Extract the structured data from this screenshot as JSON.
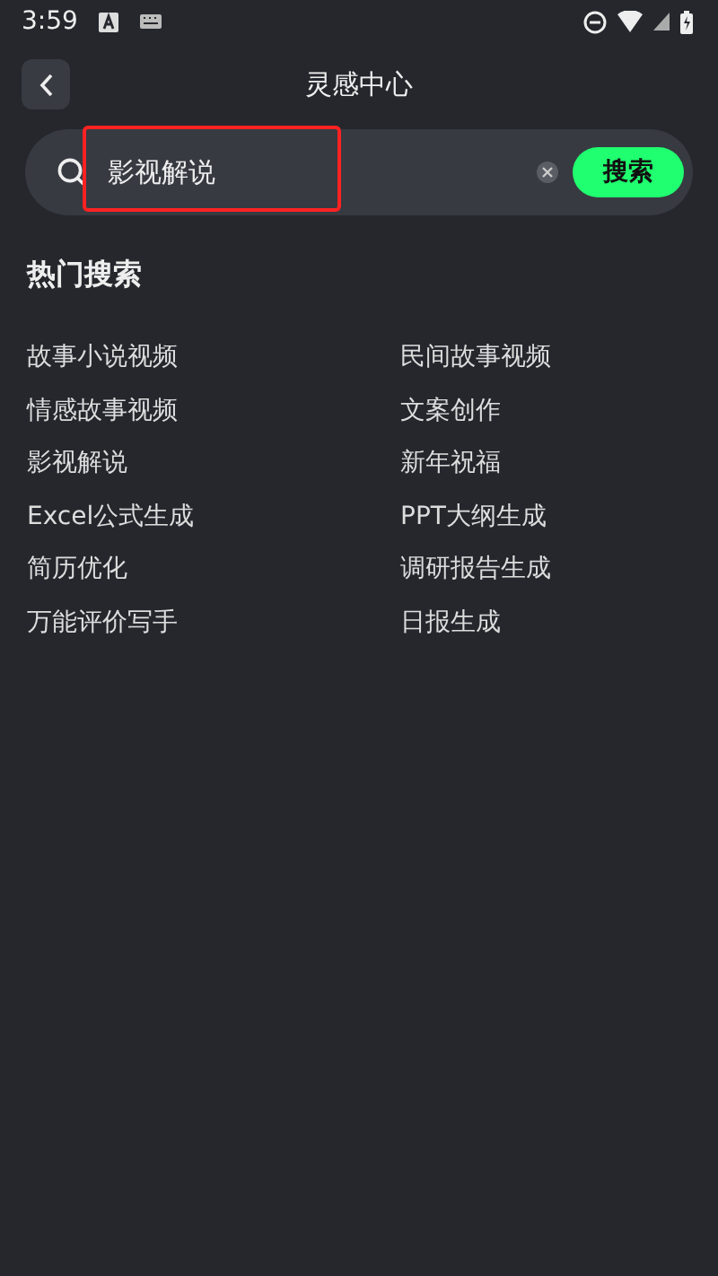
{
  "status_bar": {
    "time": "3:59"
  },
  "header": {
    "title": "灵感中心"
  },
  "search": {
    "value": "影视解说",
    "highlighted": true,
    "button": "搜索"
  },
  "hot_search": {
    "title": "热门搜索",
    "items": [
      {
        "label": "故事小说视频"
      },
      {
        "label": "民间故事视频"
      },
      {
        "label": "情感故事视频"
      },
      {
        "label": "文案创作"
      },
      {
        "label": "影视解说"
      },
      {
        "label": "新年祝福"
      },
      {
        "label": "Excel公式生成"
      },
      {
        "label": "PPT大纲生成"
      },
      {
        "label": "简历优化"
      },
      {
        "label": "调研报告生成"
      },
      {
        "label": "万能评价写手"
      },
      {
        "label": "日报生成"
      }
    ]
  }
}
